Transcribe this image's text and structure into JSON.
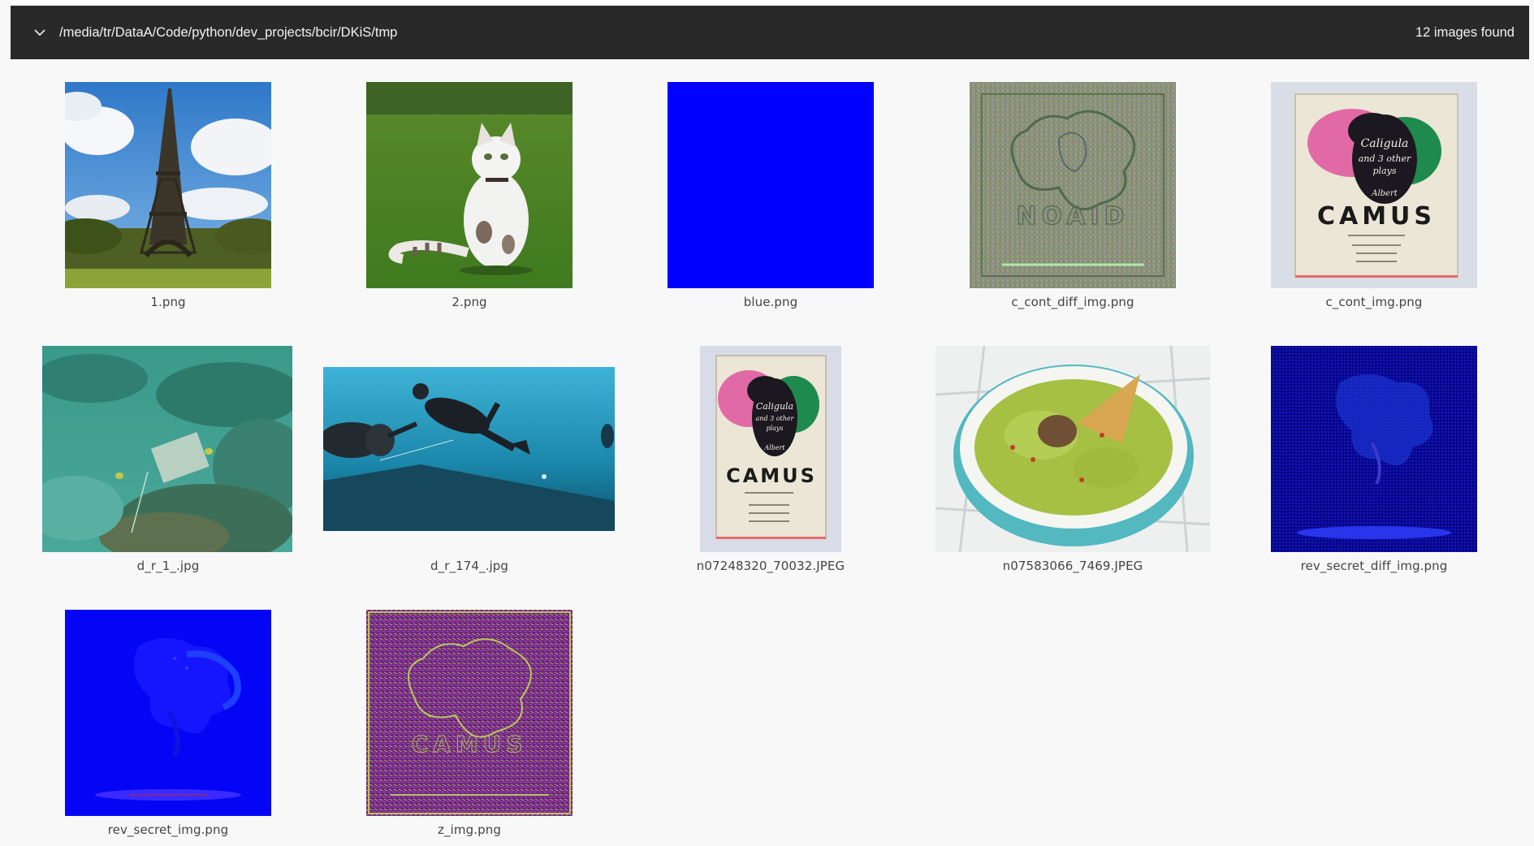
{
  "header": {
    "path": "/media/tr/DataA/Code/python/dev_projects/bcir/DKiS/tmp",
    "count_label": "12 images found"
  },
  "images": [
    {
      "name": "1.png",
      "icon": "eiffel-tower-photo"
    },
    {
      "name": "2.png",
      "icon": "cat-on-grass-photo"
    },
    {
      "name": "blue.png",
      "icon": "solid-blue-image"
    },
    {
      "name": "c_cont_diff_img.png",
      "icon": "noisy-diff-image"
    },
    {
      "name": "c_cont_img.png",
      "icon": "camus-book-cover-photo"
    },
    {
      "name": "d_r_1_.jpg",
      "icon": "underwater-reef-photo"
    },
    {
      "name": "d_r_174_.jpg",
      "icon": "scuba-diver-photo"
    },
    {
      "name": "n07248320_70032.JPEG",
      "icon": "camus-book-cover-photo"
    },
    {
      "name": "n07583066_7469.JPEG",
      "icon": "guacamole-bowl-photo"
    },
    {
      "name": "rev_secret_diff_img.png",
      "icon": "dark-blue-noise-image"
    },
    {
      "name": "rev_secret_img.png",
      "icon": "blue-revealed-image"
    },
    {
      "name": "z_img.png",
      "icon": "purple-noise-image"
    }
  ],
  "colors": {
    "header_bg": "#292929",
    "page_bg": "#f8f8f8",
    "pure_blue": "#0000ff"
  },
  "book": {
    "title_text": "Caligula and 3 other plays",
    "author_first": "Albert",
    "author_last": "CAMUS"
  }
}
